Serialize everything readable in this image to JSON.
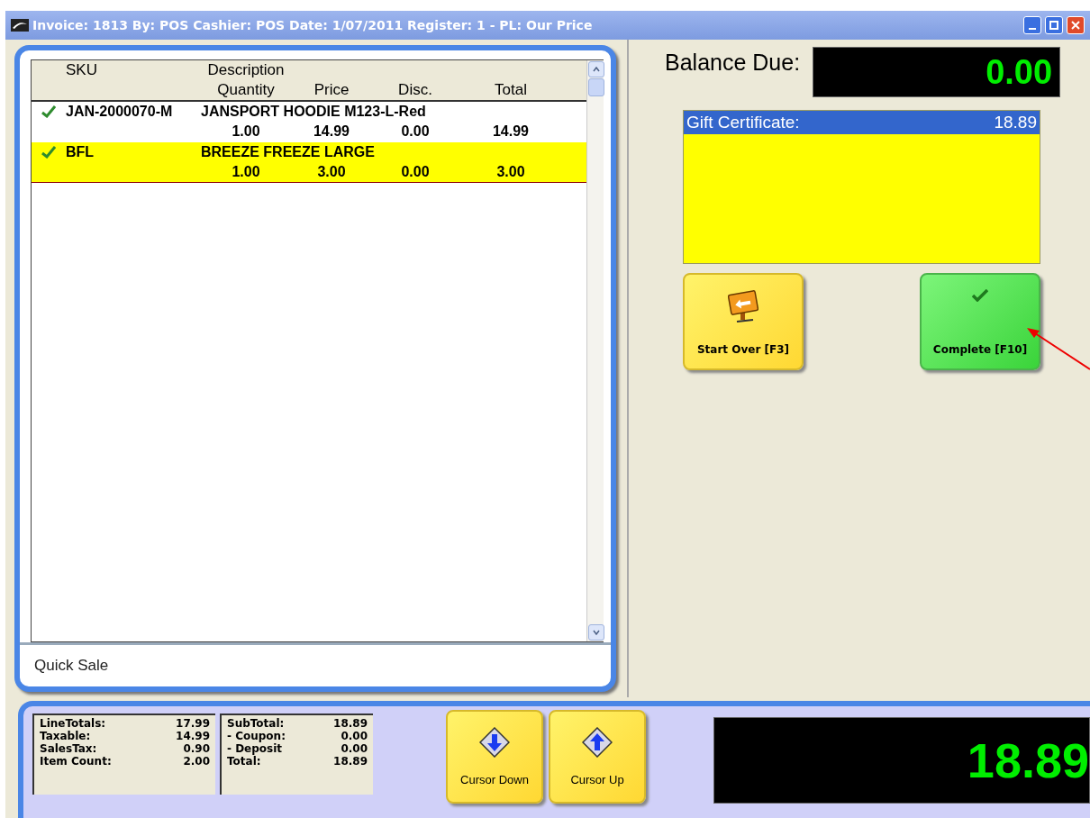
{
  "window": {
    "title": "Invoice: 1813  By: POS  Cashier: POS   Date:  1/07/2011  Register: 1 - PL: Our Price"
  },
  "table": {
    "columns_top": [
      "SKU",
      "Description"
    ],
    "columns_bottom": [
      "Quantity",
      "Price",
      "Disc.",
      "Total"
    ],
    "rows": [
      {
        "checked": true,
        "selected": false,
        "sku": "JAN-2000070-M",
        "description": "JANSPORT HOODIE M123-L-Red",
        "quantity": "1.00",
        "price": "14.99",
        "disc": "0.00",
        "total": "14.99"
      },
      {
        "checked": true,
        "selected": true,
        "sku": "BFL",
        "description": "BREEZE FREEZE LARGE",
        "quantity": "1.00",
        "price": "3.00",
        "disc": "0.00",
        "total": "3.00"
      }
    ]
  },
  "quick_sale": "Quick Sale",
  "balance_due": {
    "label": "Balance Due:",
    "value": "0.00"
  },
  "tenders": [
    {
      "label": "Gift Certificate:",
      "amount": "18.89",
      "selected": true
    }
  ],
  "actions": [
    {
      "kind": "start_over",
      "label": "Start Over [F3]"
    },
    {
      "kind": "complete",
      "label": "Complete [F10]"
    }
  ],
  "totals_left": [
    {
      "label": "LineTotals:",
      "value": "17.99"
    },
    {
      "label": "Taxable:",
      "value": "14.99"
    },
    {
      "label": "SalesTax:",
      "value": "0.90"
    },
    {
      "label": "Item Count:",
      "value": "2.00"
    }
  ],
  "totals_right": [
    {
      "label": "SubTotal:",
      "value": "18.89"
    },
    {
      "label": "- Coupon:",
      "value": "0.00"
    },
    {
      "label": "- Deposit",
      "value": "0.00"
    },
    {
      "label": "Total:",
      "value": "18.89"
    }
  ],
  "cursor_buttons": [
    {
      "kind": "down",
      "label": "Cursor Down"
    },
    {
      "kind": "up",
      "label": "Cursor Up"
    }
  ],
  "grand_total": "18.89"
}
